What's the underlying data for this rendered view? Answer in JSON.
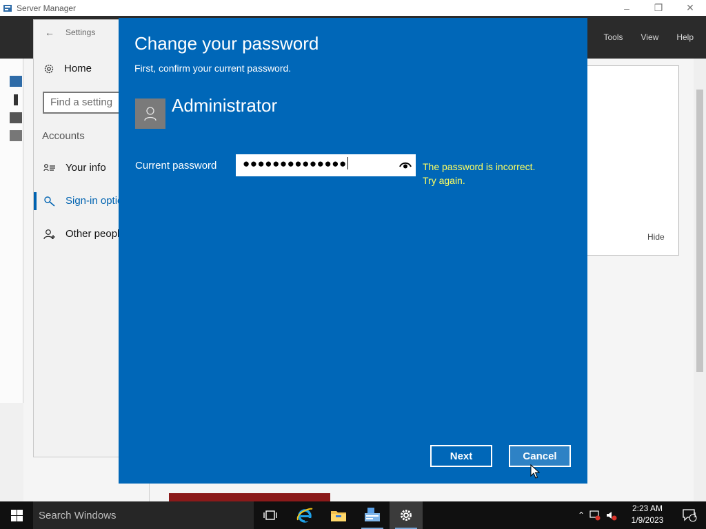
{
  "server_manager": {
    "title": "Server Manager",
    "menu": [
      "Tools",
      "View",
      "Help"
    ],
    "panel_hide_label": "Hide"
  },
  "settings": {
    "title": "Settings",
    "home_label": "Home",
    "search_placeholder": "Find a setting",
    "section_label": "Accounts",
    "items": [
      {
        "label": "Your info"
      },
      {
        "label": "Sign-in options"
      },
      {
        "label": "Other people"
      }
    ]
  },
  "dialog": {
    "title": "Change your password",
    "subtitle": "First, confirm your current password.",
    "username": "Administrator",
    "password_label": "Current password",
    "password_value": "●●●●●●●●●●●●●●",
    "error_line1": "The password is incorrect.",
    "error_line2": "Try again.",
    "next_label": "Next",
    "cancel_label": "Cancel"
  },
  "taskbar": {
    "search_placeholder": "Search Windows",
    "time": "2:23 AM",
    "date": "1/9/2023",
    "notification_count": "1"
  },
  "colors": {
    "dialog_bg": "#0067b8",
    "error_text": "#ffff60",
    "accent": "#0063b1"
  },
  "icons": {
    "start": "windows-logo-icon",
    "task_view": "task-view-icon",
    "browser": "internet-explorer-icon",
    "explorer": "file-explorer-icon",
    "server_manager": "server-manager-icon",
    "settings": "gear-icon",
    "reveal": "eye-icon",
    "avatar": "user-icon"
  }
}
